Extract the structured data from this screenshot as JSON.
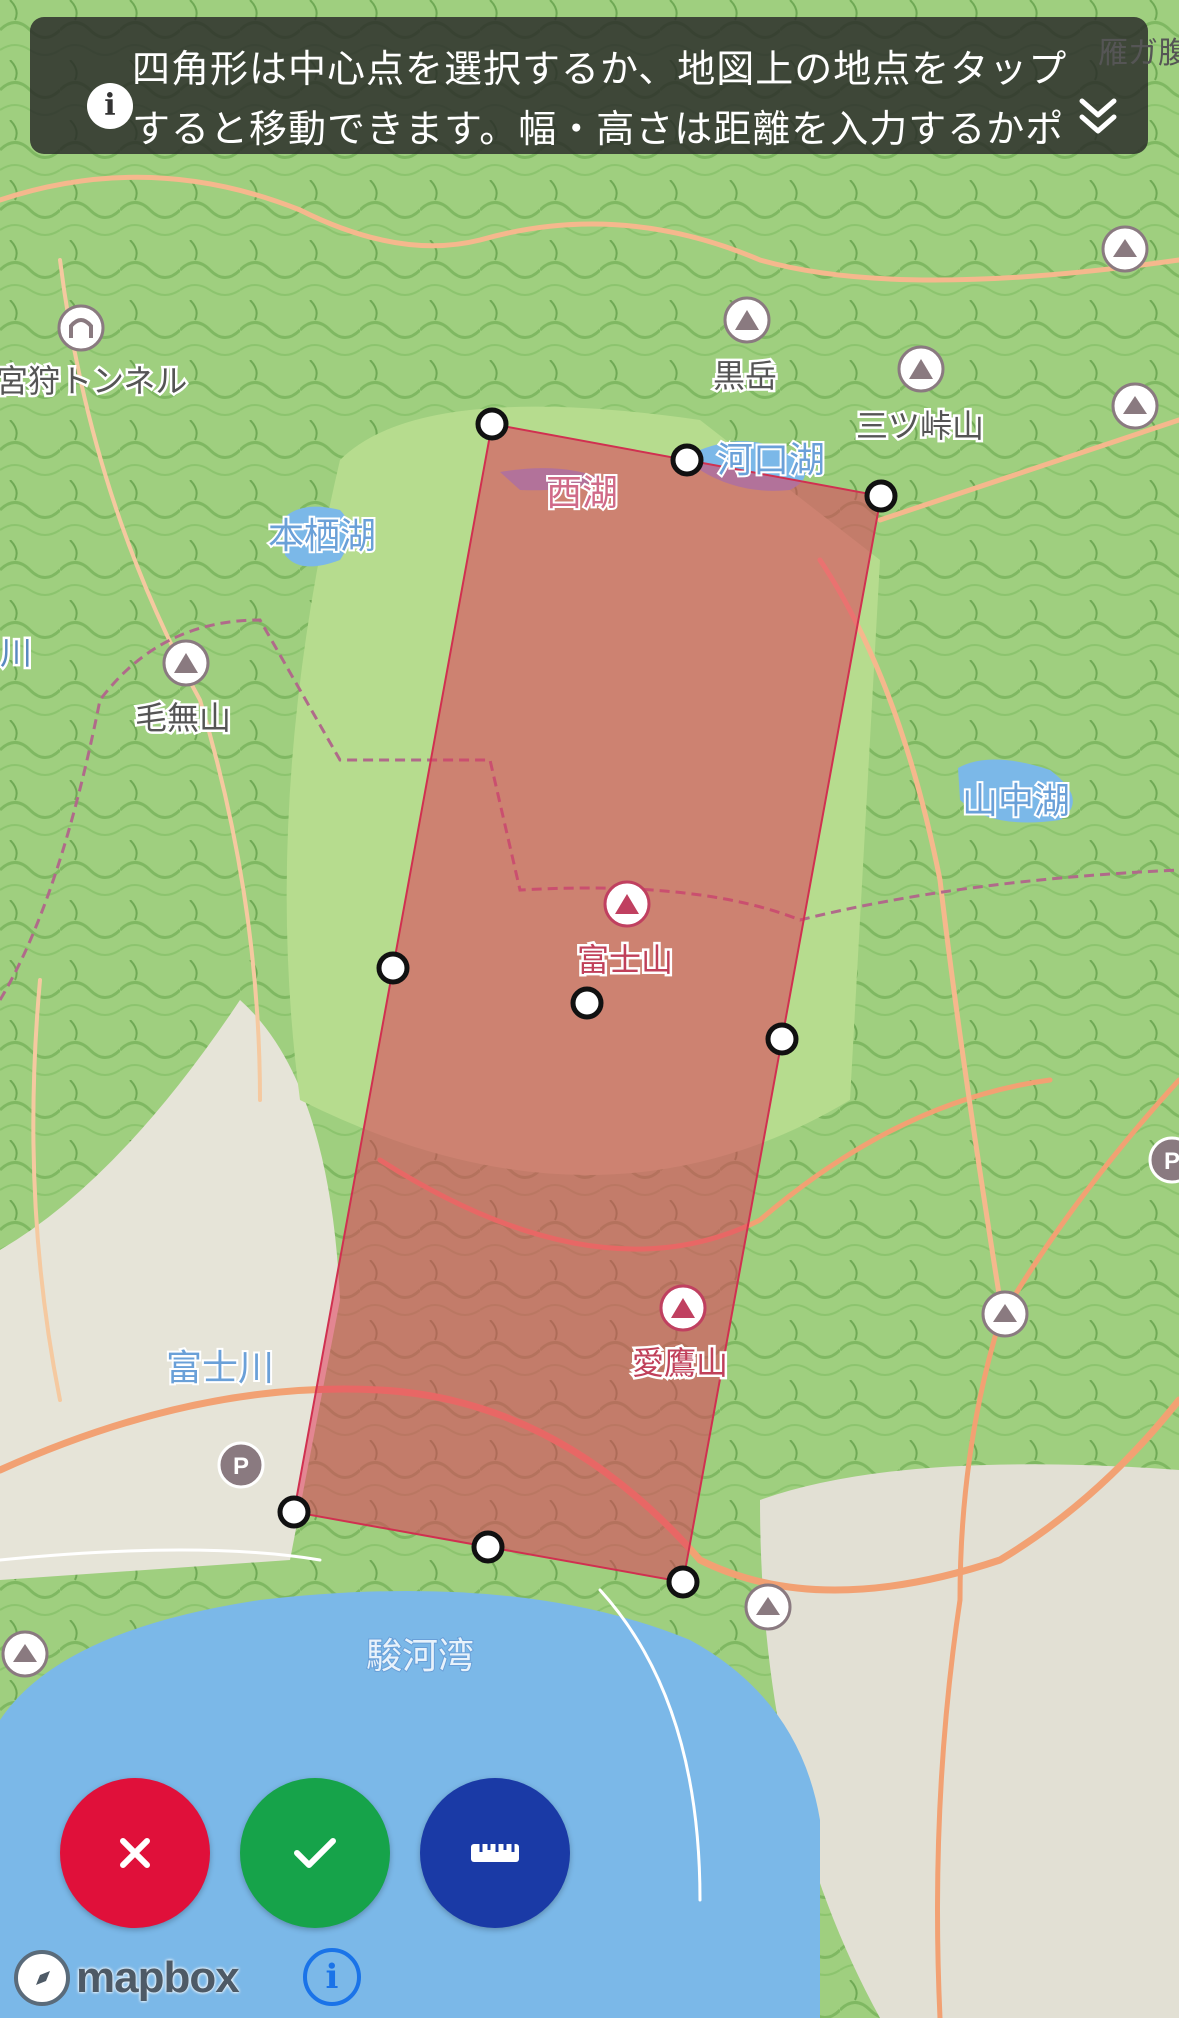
{
  "banner": {
    "line1": "四角形は中心点を選択するか、地図上の地点をタップ",
    "line2": "すると移動できます。幅・高さは距離を入力するかポ",
    "edge_label": "雁ガ腹"
  },
  "map_labels": {
    "tunnel": "宮狩トンネル",
    "lake_nishi": "西湖",
    "lake_kawaguchi": "河口湖",
    "lake_motosu": "本栖湖",
    "lake_yamanaka": "山中湖",
    "kuro": "黒岳",
    "mitsutoge": "三ツ峠山",
    "kenashi": "毛無山",
    "fuji": "富士山",
    "ashitaka": "愛鷹山",
    "fujikawa": "富士川",
    "suruga": "駿河湾",
    "left_edge": "川",
    "parking": "P",
    "right_edge_p": "P"
  },
  "buttons": {
    "cancel_icon": "close-icon",
    "confirm_icon": "check-icon",
    "measure_icon": "ruler-icon"
  },
  "attribution": {
    "brand": "mapbox",
    "info": "i"
  },
  "colors": {
    "cancel": "#e0103a",
    "confirm": "#16a34a",
    "measure": "#1a3aa6",
    "selection_fill": "#e0385a",
    "water": "#7bb8e8"
  }
}
